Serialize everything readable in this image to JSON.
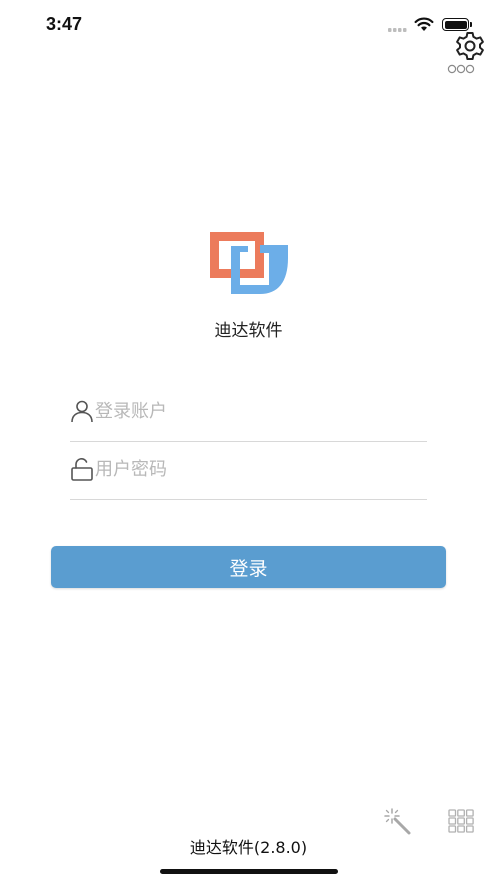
{
  "status_bar": {
    "time": "3:47"
  },
  "app": {
    "name": "迪达软件",
    "version_label": "迪达软件(2.8.0)",
    "logo_colors": {
      "orange": "#ec7b5c",
      "blue": "#6caee8"
    }
  },
  "form": {
    "account": {
      "placeholder": "登录账户",
      "value": ""
    },
    "password": {
      "placeholder": "用户密码",
      "value": ""
    },
    "login_label": "登录"
  },
  "colors": {
    "primary_button": "#5a9dd0",
    "placeholder_text": "#b8b8b8",
    "divider": "#d8d8d8"
  },
  "icons": {
    "settings": "gear-icon",
    "more": "more-dots-icon",
    "account": "user-icon",
    "password": "lock-icon",
    "tool": "magic-wand-icon",
    "apps": "grid-icon"
  }
}
